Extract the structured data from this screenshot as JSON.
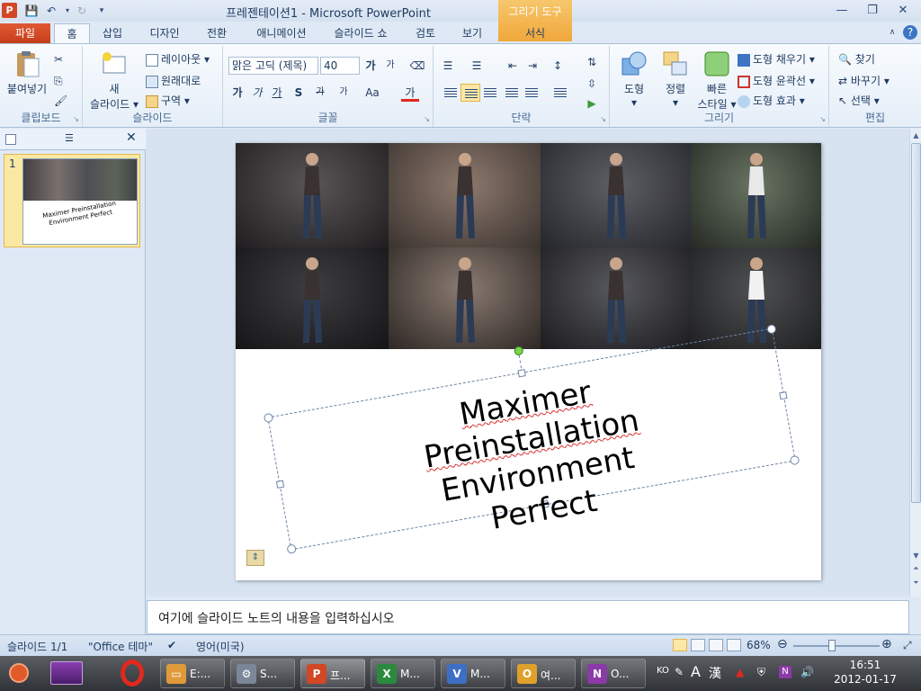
{
  "app": {
    "window_title": "프레젠테이션1  -  Microsoft PowerPoint",
    "contextual_group": "그리기 도구"
  },
  "tabs": {
    "file": "파일",
    "items": [
      "홈",
      "삽입",
      "디자인",
      "전환",
      "애니메이션",
      "슬라이드 쇼",
      "검토",
      "보기"
    ],
    "format": "서식",
    "active": "홈"
  },
  "ribbon": {
    "clipboard": {
      "label": "클립보드",
      "paste": "붙여넣기"
    },
    "slides": {
      "label": "슬라이드",
      "new_slide_line1": "새",
      "new_slide_line2": "슬라이드",
      "layout": "레이아웃",
      "reset": "원래대로",
      "section": "구역"
    },
    "font": {
      "label": "글꼴",
      "font_name": "맑은 고딕 (제목)",
      "font_size": "40"
    },
    "paragraph": {
      "label": "단락"
    },
    "drawing": {
      "label": "그리기",
      "shapes": "도형",
      "arrange": "정렬",
      "quick_styles_line1": "빠른",
      "quick_styles_line2": "스타일",
      "fill": "도형 채우기",
      "outline": "도형 윤곽선",
      "effects": "도형 효과"
    },
    "editing": {
      "label": "편집",
      "find": "찾기",
      "replace": "바꾸기",
      "select": "선택"
    }
  },
  "thumbnail": {
    "number": "1",
    "title": "Maximer Preinstallation Environment Perfect"
  },
  "slide": {
    "title_lines": [
      "Maximer",
      "Preinstallation",
      "Environment",
      "Perfect"
    ]
  },
  "notes": {
    "placeholder": "여기에 슬라이드 노트의 내용을 입력하십시오"
  },
  "status": {
    "slide_count": "슬라이드 1/1",
    "theme": "\"Office 테마\"",
    "language": "영어(미국)",
    "zoom": "68%",
    "zoom_fraction": 0.45
  },
  "taskbar": {
    "items": [
      {
        "label": "E:..."
      },
      {
        "label": "S..."
      },
      {
        "label": "프..."
      },
      {
        "label": "M..."
      },
      {
        "label": "M..."
      },
      {
        "label": "여..."
      },
      {
        "label": "O..."
      }
    ],
    "tray_lang": "KO",
    "tray_ime": "漢",
    "time": "16:51",
    "date": "2012-01-17"
  }
}
